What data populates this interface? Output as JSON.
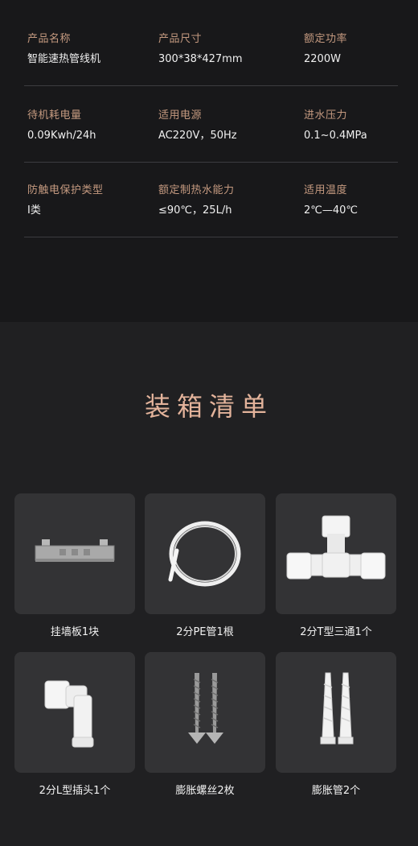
{
  "specs": {
    "rows": [
      [
        {
          "label": "产品名称",
          "value": "智能速热管线机"
        },
        {
          "label": "产品尺寸",
          "value": "300*38*427mm"
        },
        {
          "label": "额定功率",
          "value": "2200W"
        }
      ],
      [
        {
          "label": "待机耗电量",
          "value": "0.09Kwh/24h"
        },
        {
          "label": "适用电源",
          "value": "AC220V，50Hz"
        },
        {
          "label": "进水压力",
          "value": "0.1~0.4MPa"
        }
      ],
      [
        {
          "label": "防触电保护类型",
          "value": "Ⅰ类"
        },
        {
          "label": "额定制热水能力",
          "value": "≤90℃，25L/h"
        },
        {
          "label": "适用温度",
          "value": "2℃—40℃"
        }
      ]
    ]
  },
  "packing": {
    "title": "装箱清单",
    "items": [
      {
        "label": "挂墙板1块",
        "icon": "wall-plate-icon"
      },
      {
        "label": "2分PE管1根",
        "icon": "pe-tube-icon"
      },
      {
        "label": "2分T型三通1个",
        "icon": "tee-connector-icon"
      },
      {
        "label": "2分L型插头1个",
        "icon": "elbow-connector-icon"
      },
      {
        "label": "膨胀螺丝2枚",
        "icon": "screws-icon"
      },
      {
        "label": "膨胀管2个",
        "icon": "wall-anchor-icon"
      }
    ]
  },
  "colors": {
    "spec_label": "#c59a80",
    "title": "#e3b39b",
    "card_bg": "#333335"
  }
}
